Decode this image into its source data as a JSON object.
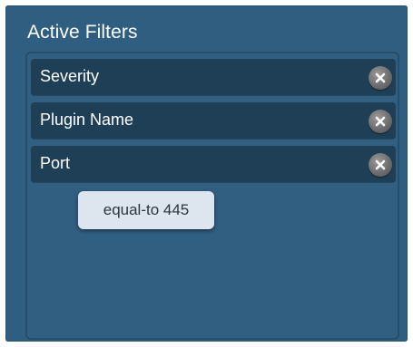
{
  "panel": {
    "title": "Active Filters"
  },
  "filters": [
    {
      "label": "Severity",
      "remove_icon": "close-circle-icon"
    },
    {
      "label": "Plugin Name",
      "remove_icon": "close-circle-icon"
    },
    {
      "label": "Port",
      "remove_icon": "close-circle-icon"
    }
  ],
  "tooltip": {
    "text": "equal-to 445"
  },
  "colors": {
    "panel_bg": "#2f5e80",
    "row_bg": "#1e3f56",
    "tooltip_bg": "#dde6ee"
  }
}
